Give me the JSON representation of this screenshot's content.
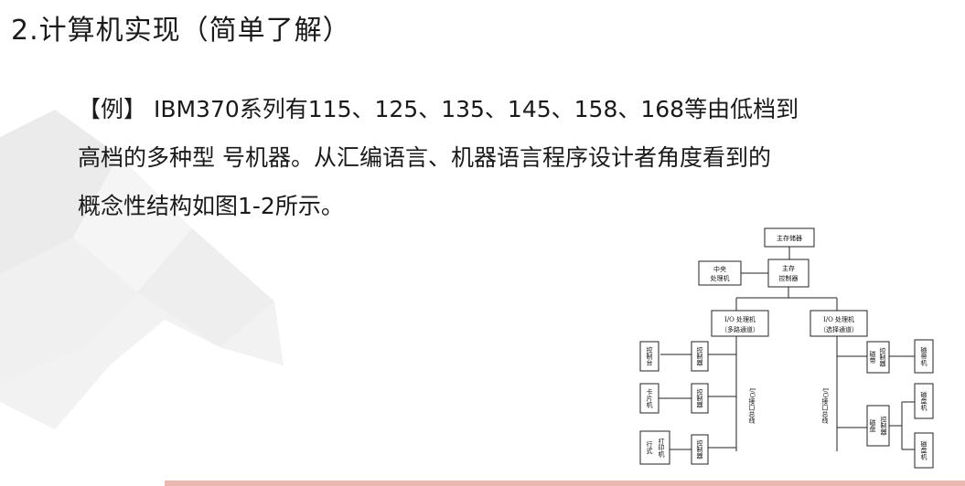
{
  "title": "2.计算机实现（简单了解）",
  "paragraph": {
    "line1": "【例】 IBM370系列有115、125、135、145、158、168等由低档到",
    "line2": "高档的多种型 号机器。从汇编语言、机器语言程序设计者角度看到的",
    "line3": "概念性结构如图1-2所示。"
  },
  "figure": {
    "main_memory": "主存储器",
    "cpu": [
      "中央",
      "处理机"
    ],
    "mem_ctrl": [
      "主存",
      "控制器"
    ],
    "io_mux": [
      "I/O 处理机",
      "（多路通道）"
    ],
    "io_sel": [
      "I/O 处理机",
      "（选择通道）"
    ],
    "console": "控制台",
    "card_reader": "卡片机",
    "printer": "打印机",
    "printer_prefix": "行式",
    "controller": "控制器",
    "io_bus": "I/O接口总线",
    "tape": "磁带机",
    "tape_ctrl_prefix": "磁带",
    "disk_ctrl_prefix": "磁盘",
    "disk1": "磁盘机",
    "disk2": "磁盘机"
  },
  "colors": {
    "text": "#1a1a1a",
    "deco": "#efefef",
    "accent_bar": "#e9b8b0"
  }
}
